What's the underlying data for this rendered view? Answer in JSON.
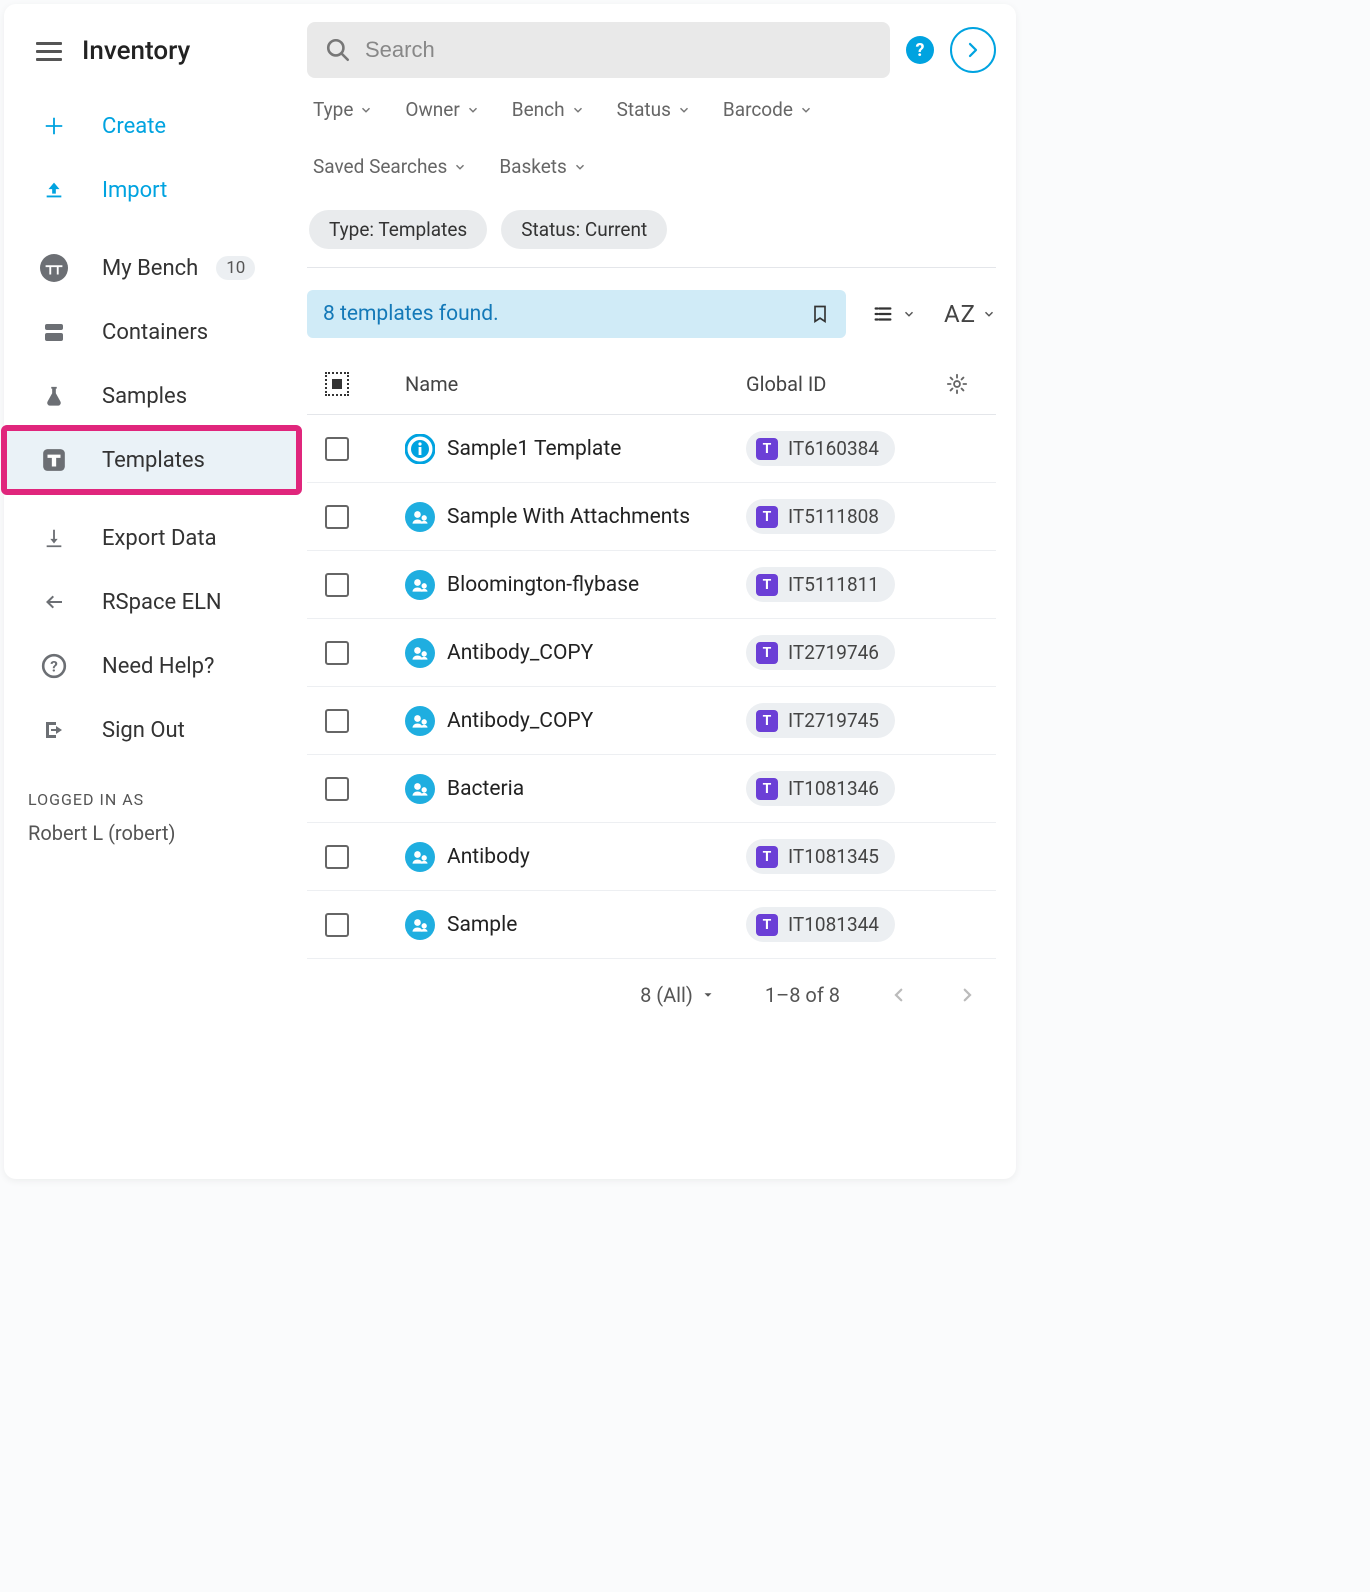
{
  "app": {
    "title": "Inventory"
  },
  "sidebar": {
    "create": "Create",
    "import": "Import",
    "mybench": {
      "label": "My Bench",
      "count": "10"
    },
    "containers": "Containers",
    "samples": "Samples",
    "templates": "Templates",
    "export": "Export Data",
    "eln": "RSpace ELN",
    "help": "Need Help?",
    "signout": "Sign Out"
  },
  "footer": {
    "label": "LOGGED IN AS",
    "user": "Robert L (robert)"
  },
  "search": {
    "placeholder": "Search"
  },
  "filters": {
    "type": "Type",
    "owner": "Owner",
    "bench": "Bench",
    "status": "Status",
    "barcode": "Barcode",
    "saved": "Saved Searches",
    "baskets": "Baskets"
  },
  "chips": {
    "type": "Type: Templates",
    "status": "Status: Current"
  },
  "found": "8 templates found.",
  "sort_label": "AZ",
  "columns": {
    "name": "Name",
    "gid": "Global ID"
  },
  "rows": [
    {
      "name": "Sample1 Template",
      "gid": "IT6160384",
      "icon": "info"
    },
    {
      "name": "Sample With Attachments",
      "gid": "IT5111808",
      "icon": "shared"
    },
    {
      "name": "Bloomington-flybase",
      "gid": "IT5111811",
      "icon": "shared"
    },
    {
      "name": "Antibody_COPY",
      "gid": "IT2719746",
      "icon": "shared"
    },
    {
      "name": "Antibody_COPY",
      "gid": "IT2719745",
      "icon": "shared"
    },
    {
      "name": "Bacteria",
      "gid": "IT1081346",
      "icon": "shared"
    },
    {
      "name": "Antibody",
      "gid": "IT1081345",
      "icon": "shared"
    },
    {
      "name": "Sample",
      "gid": "IT1081344",
      "icon": "shared"
    }
  ],
  "pager": {
    "size": "8 (All)",
    "range": "1–8 of 8"
  }
}
